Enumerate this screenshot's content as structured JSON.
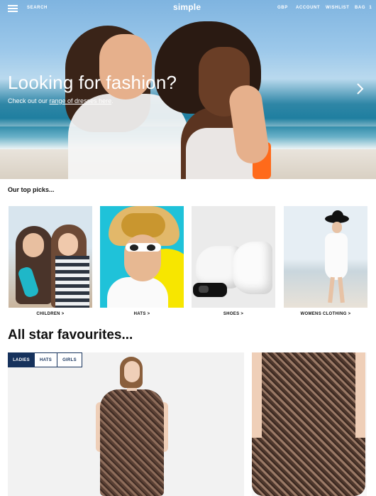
{
  "header": {
    "search_label": "SEARCH",
    "brand": "simple",
    "currency_label": "GBP",
    "account_label": "ACCOUNT",
    "wishlist_label": "WISHLIST",
    "bag_label": "BAG",
    "bag_count": "1"
  },
  "hero": {
    "title": "Looking for fashion?",
    "subtitle_prefix": "Check out our ",
    "subtitle_link": "range of dresses here",
    "subtitle_suffix": "."
  },
  "top_picks": {
    "title": "Our top picks...",
    "items": [
      {
        "label": "CHILDREN >"
      },
      {
        "label": "HATS >"
      },
      {
        "label": "SHOES >"
      },
      {
        "label": "WOMENS CLOTHING >"
      }
    ]
  },
  "favourites": {
    "title": "All star favourites...",
    "tabs": [
      "LADIES",
      "HATS",
      "GIRLS"
    ],
    "active_tab": "LADIES"
  },
  "colors": {
    "accent": "#16325c"
  }
}
